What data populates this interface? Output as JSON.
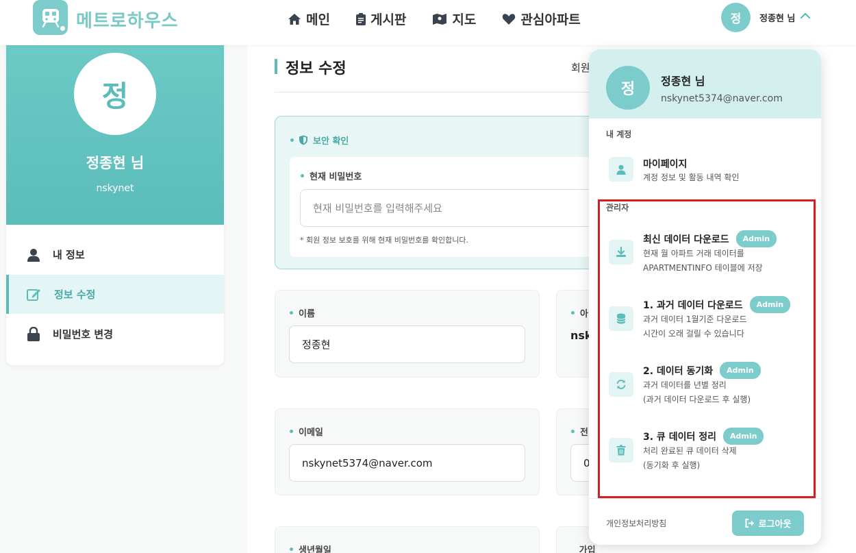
{
  "header": {
    "app_name": "메트로하우스",
    "nav": [
      {
        "label": "메인",
        "icon": "home-icon"
      },
      {
        "label": "게시판",
        "icon": "clipboard-icon"
      },
      {
        "label": "지도",
        "icon": "map-icon"
      },
      {
        "label": "관심아파트",
        "icon": "heart-icon"
      }
    ],
    "user_initial": "정",
    "user_name": "정종현 님"
  },
  "profile": {
    "initial": "정",
    "name": "정종현 님",
    "id": "nskynet",
    "menu": [
      {
        "label": "내 정보",
        "icon": "user-icon",
        "active": false
      },
      {
        "label": "정보 수정",
        "icon": "edit-icon",
        "active": true
      },
      {
        "label": "비밀번호 변경",
        "icon": "lock-icon",
        "active": false
      }
    ]
  },
  "main": {
    "title": "정보 수정",
    "tab_member": "회원",
    "security": {
      "heading": "보안 확인",
      "password_label": "현재 비밀번호",
      "password_placeholder": "현재 비밀번호를 입력해주세요",
      "note": "* 회원 정보 보호를 위해 현재 비밀번호를 확인합니다."
    },
    "fields": {
      "name_label": "이름",
      "name_value": "정종현",
      "id_label": "아",
      "id_value": "nsk",
      "email_label": "이메일",
      "email_value": "nskynet5374@naver.com",
      "phone_label": "전",
      "phone_value": "0",
      "birth_label": "생년월일",
      "joined_label": "가입일"
    }
  },
  "dropdown": {
    "initial": "정",
    "name": "정종현 님",
    "email": "nskynet5374@naver.com",
    "account_section": "내 계정",
    "mypage_title": "마이페이지",
    "mypage_desc": "계정 정보 및 활동 내역 확인",
    "admin_section": "관리자",
    "admin_items": [
      {
        "title": "최신 데이터 다운로드",
        "badge": "Admin",
        "desc1": "현재 월 아파트 거래 데이터를",
        "desc2": "APARTMENTINFO 테이블에 저장",
        "icon": "download-icon"
      },
      {
        "title": "1. 과거 데이터 다운로드",
        "badge": "Admin",
        "desc1": "과거 데이터 1월기준 다운로드",
        "desc2": "시간이 오래 걸릴 수 있습니다",
        "icon": "database-icon"
      },
      {
        "title": "2. 데이터 동기화",
        "badge": "Admin",
        "desc1": "과거 데이터를 년별 정리",
        "desc2": "(과거 데이터 다운로드 후 실행)",
        "icon": "sync-icon"
      },
      {
        "title": "3. 큐 데이터 정리",
        "badge": "Admin",
        "desc1": "처리 완료된 큐 데이터 삭제",
        "desc2": "(동기화 후 실행)",
        "icon": "trash-icon"
      }
    ],
    "privacy": "개인정보처리방침",
    "logout": "로그아웃"
  },
  "colors": {
    "accent": "#7ccccb",
    "accent_dark": "#5bbcb9",
    "highlight": "#d42020"
  }
}
